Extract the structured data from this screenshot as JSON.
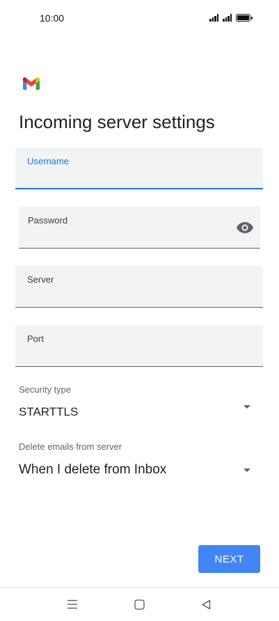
{
  "status_bar": {
    "time": "10:00"
  },
  "app": {
    "logo_icon": "gmail-logo-icon",
    "brand_colors": [
      "#ea4335",
      "#4285f4",
      "#34a853",
      "#fbbc04",
      "#c5221f"
    ]
  },
  "page": {
    "title": "Incoming server settings"
  },
  "form": {
    "username": {
      "label": "Username",
      "value": "",
      "focused": true
    },
    "password": {
      "label": "Password",
      "value": "",
      "toggle_icon": "eye-icon"
    },
    "server": {
      "label": "Server",
      "value": ""
    },
    "port": {
      "label": "Port",
      "value": ""
    },
    "security_type": {
      "label": "Security type",
      "selected": "STARTTLS"
    },
    "delete_emails": {
      "label": "Delete emails from server",
      "selected": "When I delete from Inbox"
    }
  },
  "actions": {
    "next_label": "NEXT",
    "accent": "#4285f4"
  },
  "nav_bar": {
    "icons": [
      "menu-icon",
      "home-icon",
      "back-icon"
    ]
  }
}
